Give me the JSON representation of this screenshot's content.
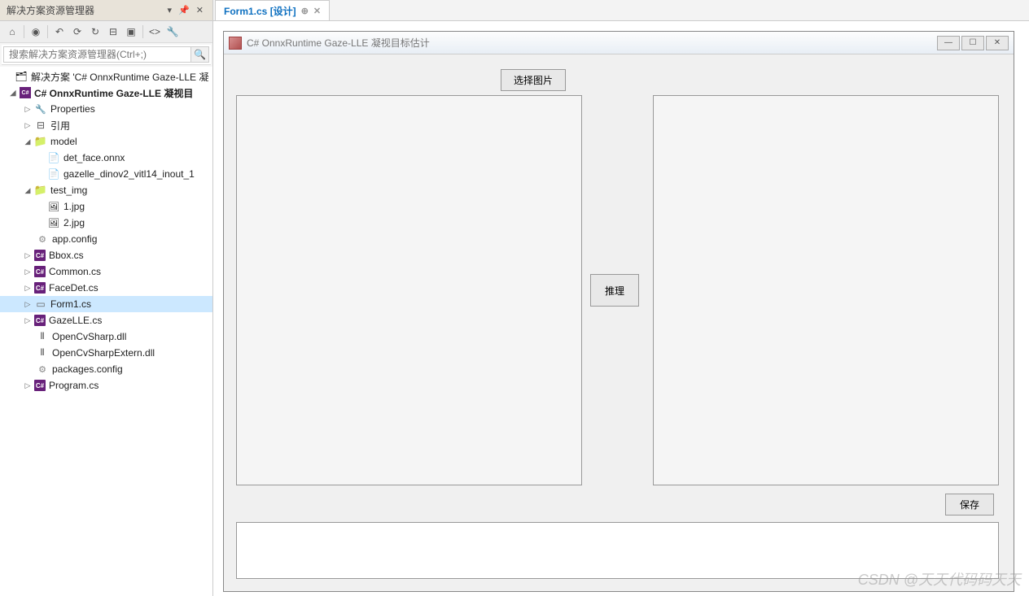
{
  "panel": {
    "title": "解决方案资源管理器",
    "search_placeholder": "搜索解决方案资源管理器(Ctrl+;)"
  },
  "tree": {
    "solution": "解决方案 'C# OnnxRuntime Gaze-LLE 凝",
    "project": "C# OnnxRuntime Gaze-LLE 凝视目",
    "properties": "Properties",
    "references": "引用",
    "folder_model": "model",
    "file_det_face": "det_face.onnx",
    "file_gazelle": "gazelle_dinov2_vitl14_inout_1",
    "folder_test_img": "test_img",
    "file_1jpg": "1.jpg",
    "file_2jpg": "2.jpg",
    "file_appconfig": "app.config",
    "file_bbox": "Bbox.cs",
    "file_common": "Common.cs",
    "file_facedet": "FaceDet.cs",
    "file_form1": "Form1.cs",
    "file_gazelle_cs": "GazeLLE.cs",
    "file_opencvsharp": "OpenCvSharp.dll",
    "file_opencvsharpextern": "OpenCvSharpExtern.dll",
    "file_packages": "packages.config",
    "file_program": "Program.cs"
  },
  "tab": {
    "label": "Form1.cs [设计]"
  },
  "form": {
    "title": "C# OnnxRuntime Gaze-LLE 凝视目标估计",
    "btn_select": "选择图片",
    "btn_infer": "推理",
    "btn_save": "保存"
  },
  "watermark": "CSDN @天天代码码天天"
}
